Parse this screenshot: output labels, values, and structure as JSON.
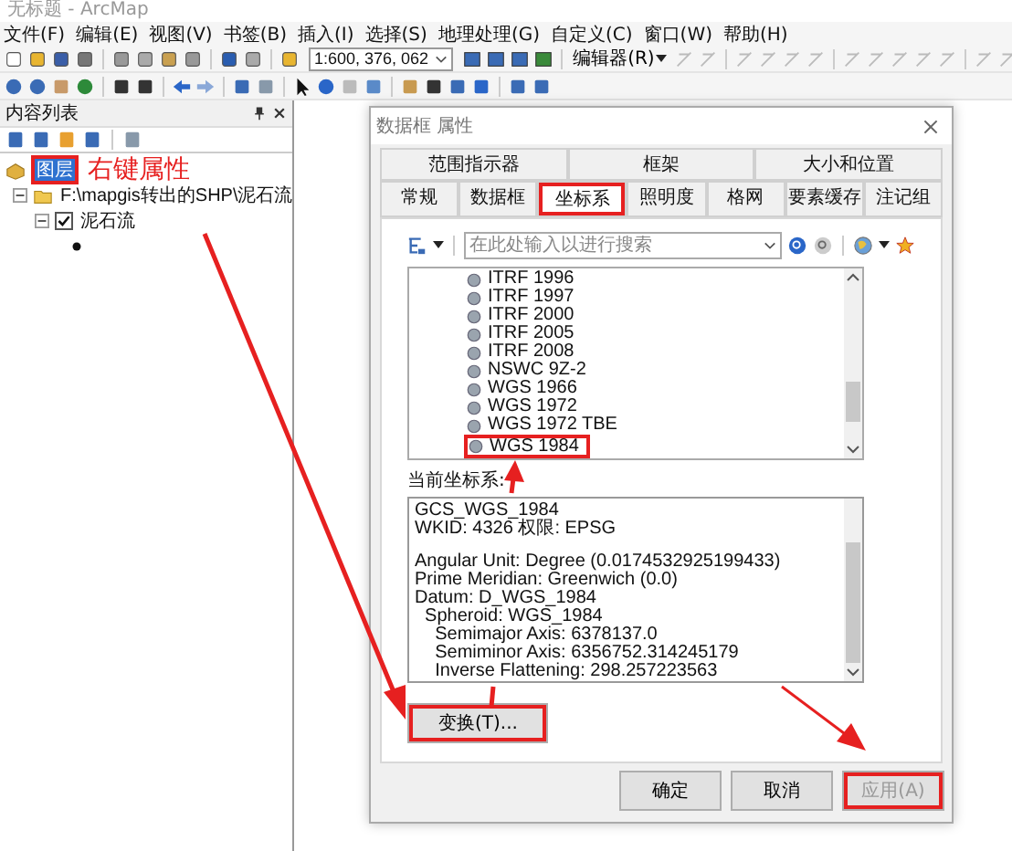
{
  "window": {
    "title": "无标题 - ArcMap"
  },
  "menu": [
    "文件(F)",
    "编辑(E)",
    "视图(V)",
    "书签(B)",
    "插入(I)",
    "选择(S)",
    "地理处理(G)",
    "自定义(C)",
    "窗口(W)",
    "帮助(H)"
  ],
  "toolbar": {
    "scale": "1:600, 376, 062",
    "editor_menu": "编辑器(R)"
  },
  "toc": {
    "title": "内容列表",
    "annotation": "右键属性",
    "layers": [
      {
        "label": "图层",
        "selected": true,
        "annotated": true,
        "children": [
          {
            "label": "F:\\mapgis转出的SHP\\泥石流",
            "expanded": true,
            "children": [
              {
                "label": "泥石流",
                "expanded": true,
                "checked": true
              }
            ]
          }
        ]
      }
    ]
  },
  "dialog": {
    "title": "数据框 属性",
    "tab_rows": [
      [
        {
          "label": "范围指示器",
          "selected": false,
          "annotated": false
        },
        {
          "label": "框架",
          "selected": false,
          "annotated": false
        },
        {
          "label": "大小和位置",
          "selected": false,
          "annotated": false
        }
      ],
      [
        {
          "label": "常规",
          "selected": false,
          "annotated": false
        },
        {
          "label": "数据框",
          "selected": false,
          "annotated": false
        },
        {
          "label": "坐标系",
          "selected": true,
          "annotated": true
        },
        {
          "label": "照明度",
          "selected": false,
          "annotated": false
        },
        {
          "label": "格网",
          "selected": false,
          "annotated": false
        },
        {
          "label": "要素缓存",
          "selected": false,
          "annotated": false
        },
        {
          "label": "注记组",
          "selected": false,
          "annotated": false
        }
      ]
    ],
    "search": {
      "placeholder": "在此处输入以进行搜索"
    },
    "crs_list": [
      {
        "label": "ITRF 1996",
        "annotated": false
      },
      {
        "label": "ITRF 1997",
        "annotated": false
      },
      {
        "label": "ITRF 2000",
        "annotated": false
      },
      {
        "label": "ITRF 2005",
        "annotated": false
      },
      {
        "label": "ITRF 2008",
        "annotated": false
      },
      {
        "label": "NSWC 9Z-2",
        "annotated": false
      },
      {
        "label": "WGS 1966",
        "annotated": false
      },
      {
        "label": "WGS 1972",
        "annotated": false
      },
      {
        "label": "WGS 1972 TBE",
        "annotated": false
      },
      {
        "label": "WGS 1984",
        "annotated": true
      }
    ],
    "current_label": "当前坐标系:",
    "current_text": [
      [
        "GCS_WGS_1984",
        "WKID: 4326 权限: EPSG"
      ],
      [
        "Angular Unit: Degree (0.0174532925199433)",
        "Prime Meridian: Greenwich (0.0)",
        "Datum: D_WGS_1984",
        "  Spheroid: WGS_1984",
        "    Semimajor Axis: 6378137.0",
        "    Semiminor Axis: 6356752.314245179",
        "    Inverse Flattening: 298.257223563"
      ]
    ],
    "transform_button": {
      "label": "变换(T)...",
      "annotated": true
    },
    "buttons": [
      {
        "label": "确定",
        "disabled": false,
        "annotated": false
      },
      {
        "label": "取消",
        "disabled": false,
        "annotated": false
      },
      {
        "label": "应用(A)",
        "disabled": true,
        "annotated": true
      }
    ]
  }
}
